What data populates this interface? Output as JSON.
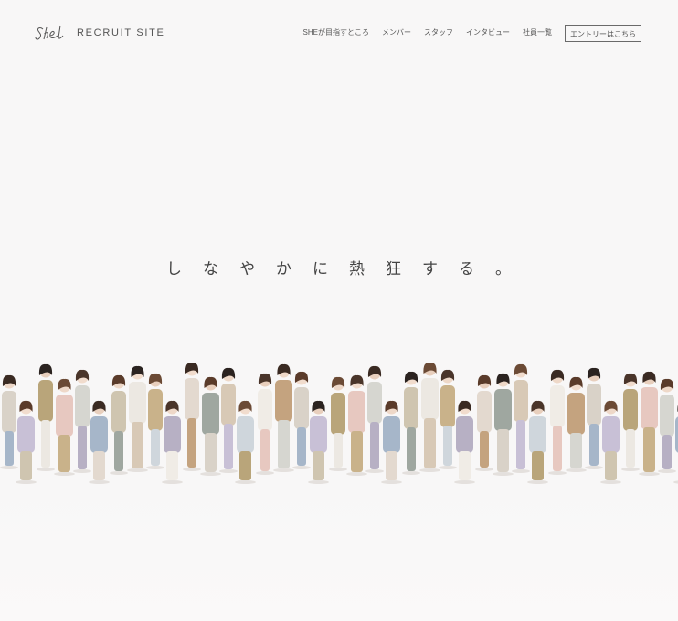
{
  "header": {
    "logo_text": "SHE",
    "site_label": "RECRUIT SITE",
    "nav": [
      {
        "label": "SHEが目指すところ"
      },
      {
        "label": "メンバー"
      },
      {
        "label": "スタッフ"
      },
      {
        "label": "インタビュー"
      },
      {
        "label": "社員一覧"
      }
    ],
    "entry_button": "エントリーはこちら"
  },
  "hero": {
    "tagline": "しなやかに熱狂する。"
  },
  "colors": {
    "background": "#f8f7f7",
    "text": "#4a4a4a"
  }
}
